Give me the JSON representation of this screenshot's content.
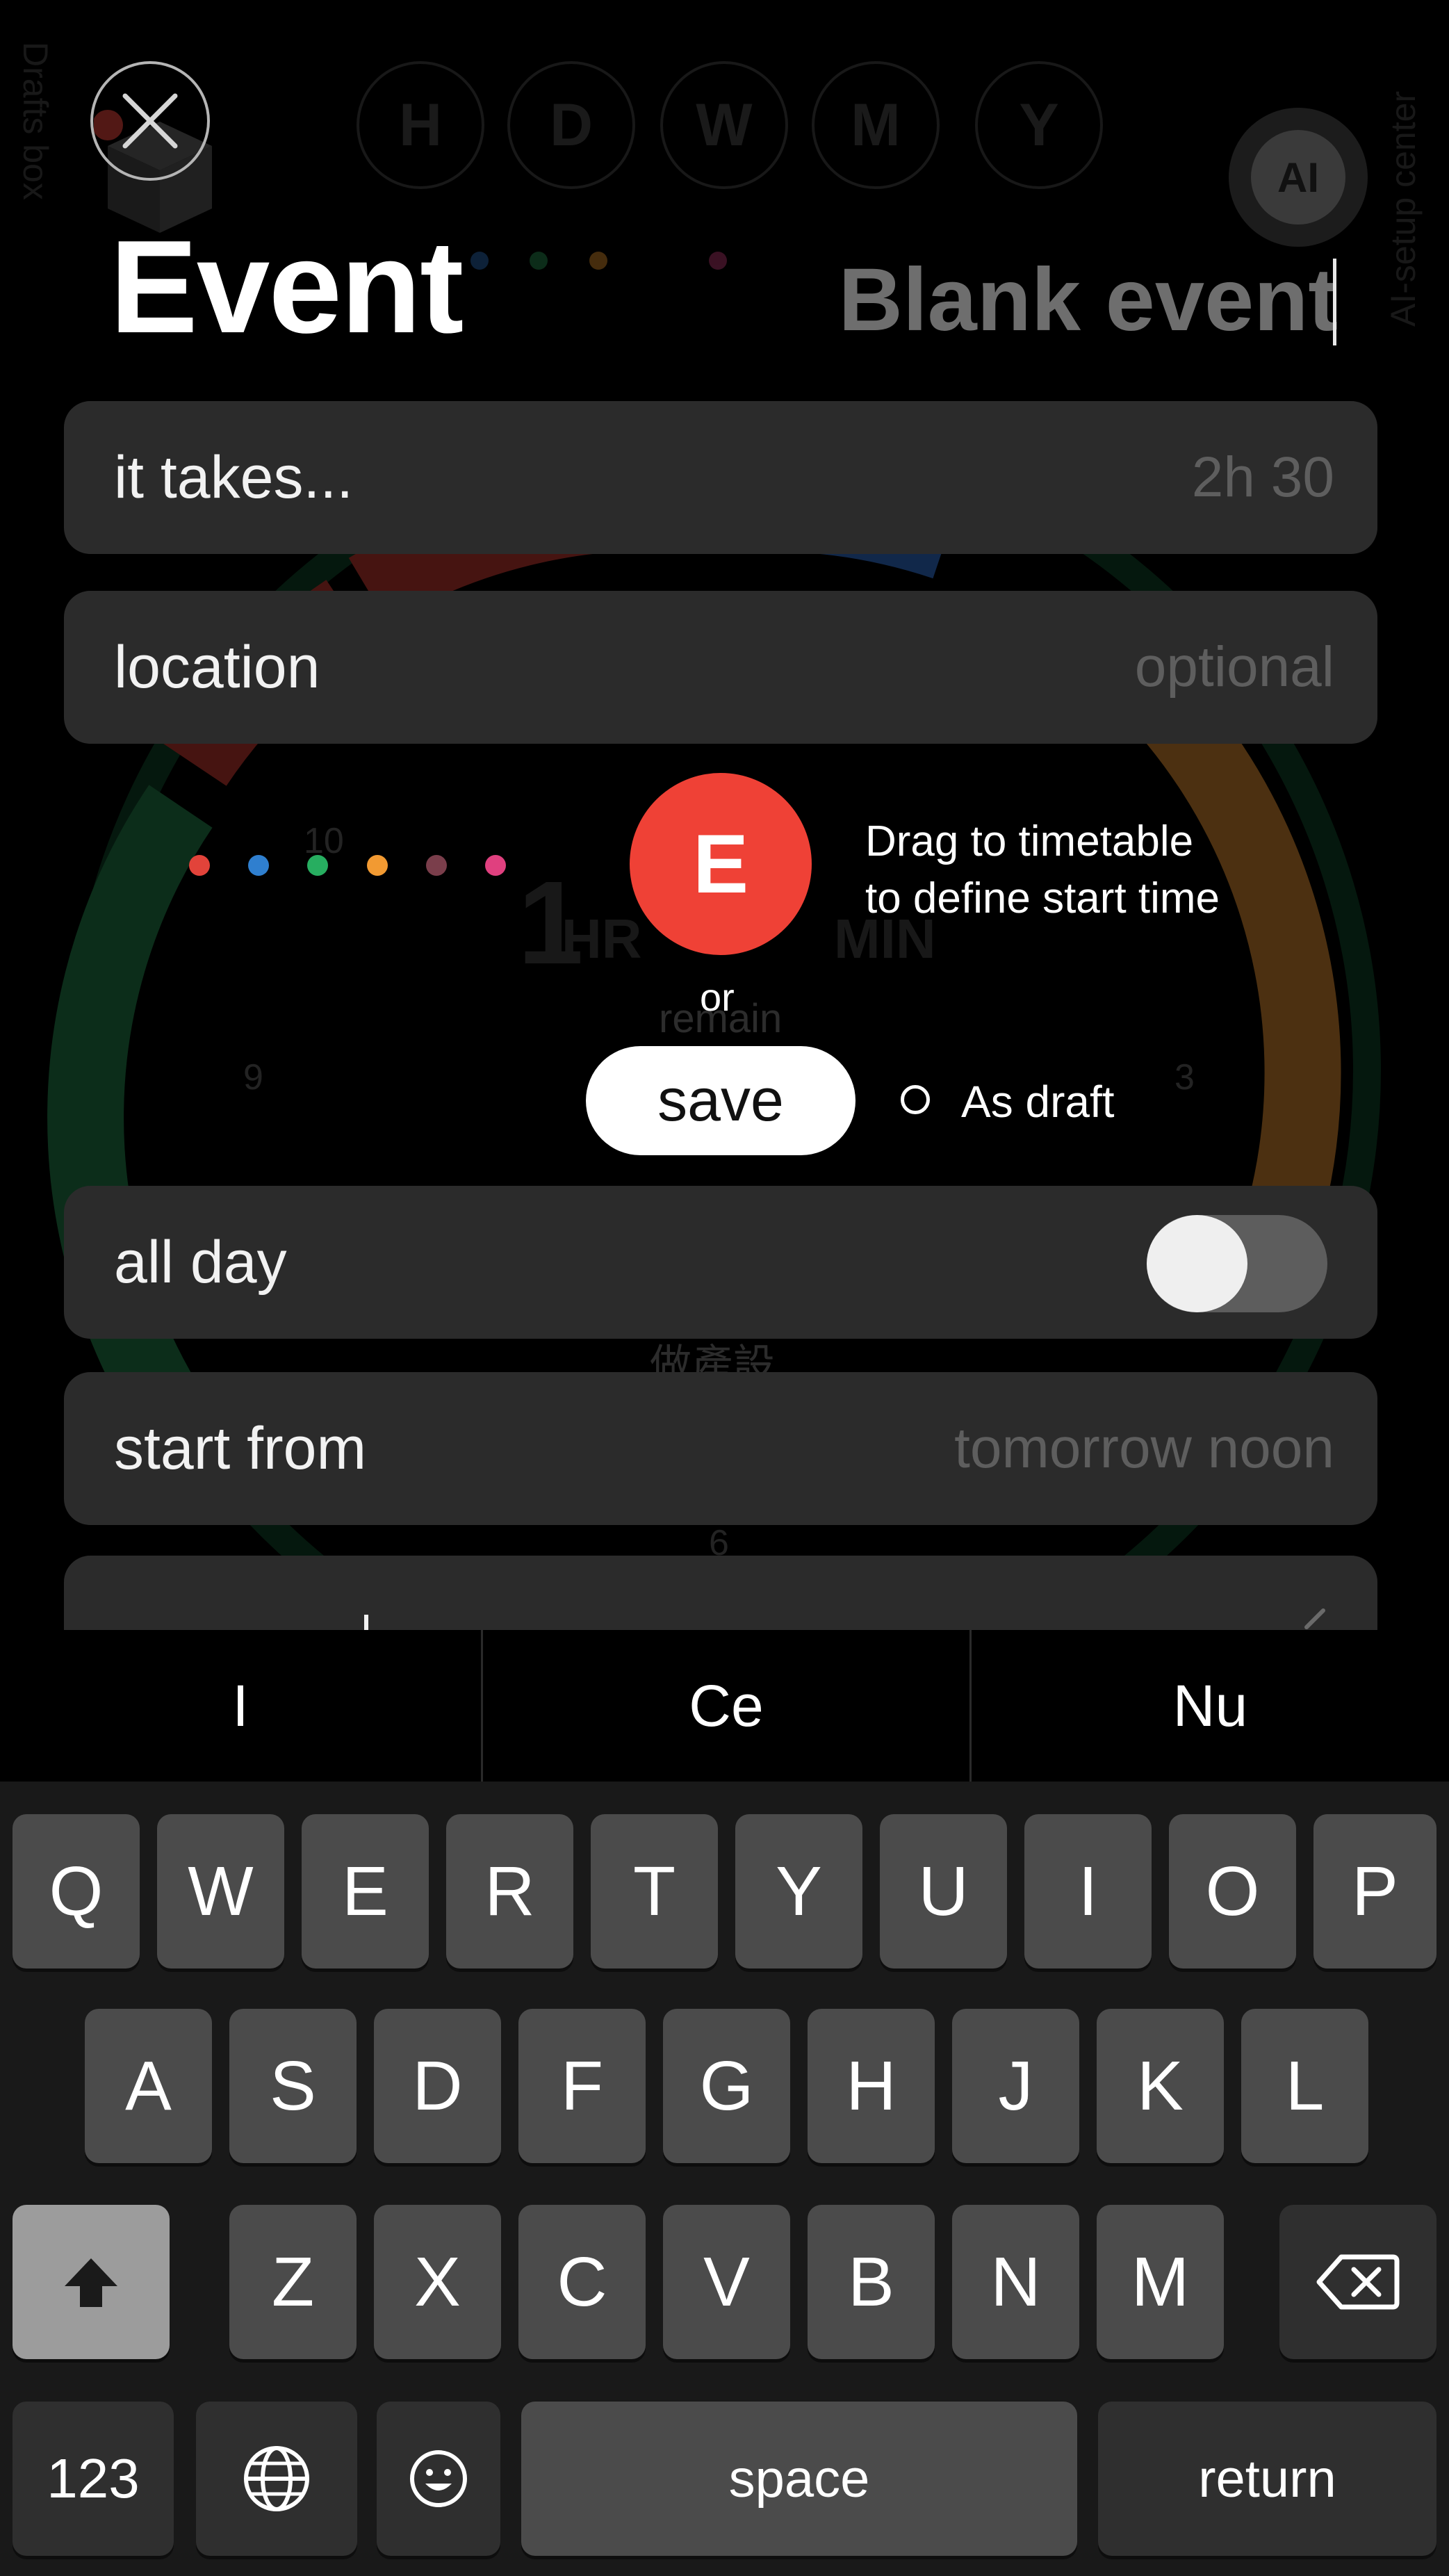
{
  "background": {
    "period_buttons": [
      "H",
      "D",
      "W",
      "M",
      "Y"
    ],
    "left_vertical_label": "Drafts box",
    "right_vertical_label": "AI-setup center",
    "ai_label": "AI",
    "dial_numbers": {
      "ten": "10",
      "nine": "9",
      "three": "3",
      "six": "6"
    },
    "remain_hr_value": "1",
    "remain_hr_unit": "HR",
    "remain_min_unit": "MIN",
    "remain_label": "remain",
    "chinese_label": "做產設"
  },
  "header": {
    "title": "Event",
    "event_name": "Blank event"
  },
  "form": {
    "duration": {
      "label": "it takes...",
      "value": "2h 30"
    },
    "location": {
      "label": "location",
      "placeholder": "optional"
    },
    "all_day": {
      "label": "all day",
      "on": false
    },
    "start_from": {
      "label": "start from",
      "value": "tomorrow noon"
    }
  },
  "actions": {
    "badge_letter": "E",
    "drag_hint_line1": "Drag to timetable",
    "drag_hint_line2": "to define start time",
    "or": "or",
    "save": "save",
    "as_draft": "As draft"
  },
  "color_options": [
    "#e2433a",
    "#2f7fcf",
    "#27ae60",
    "#f29a32",
    "#7a3e4b",
    "#e0407f"
  ],
  "keyboard": {
    "suggestions": [
      "I",
      "Ce",
      "Nu"
    ],
    "row1": [
      "Q",
      "W",
      "E",
      "R",
      "T",
      "Y",
      "U",
      "I",
      "O",
      "P"
    ],
    "row2": [
      "A",
      "S",
      "D",
      "F",
      "G",
      "H",
      "J",
      "K",
      "L"
    ],
    "row3": [
      "Z",
      "X",
      "C",
      "V",
      "B",
      "N",
      "M"
    ],
    "numbers_key": "123",
    "space_key": "space",
    "return_key": "return",
    "shift_icon": "shift-icon",
    "delete_icon": "delete-icon",
    "globe_icon": "globe-icon",
    "emoji_icon": "emoji-icon"
  }
}
